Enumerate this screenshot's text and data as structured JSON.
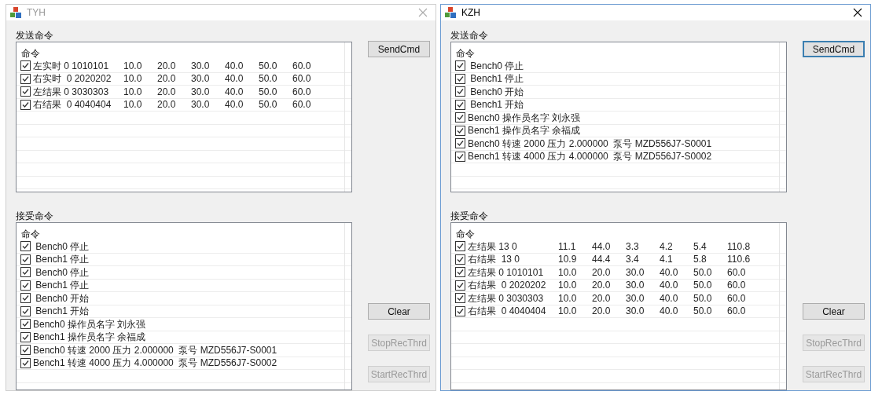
{
  "windows": [
    {
      "title": "TYH",
      "active": false,
      "send": {
        "label": "发送命令",
        "header": "命令",
        "rows": [
          {
            "checked": true,
            "cells": [
              "左实时 0 1010101",
              "10.0",
              "20.0",
              "30.0",
              "40.0",
              "50.0",
              "60.0"
            ]
          },
          {
            "checked": true,
            "cells": [
              "右实时  0 2020202",
              "10.0",
              "20.0",
              "30.0",
              "40.0",
              "50.0",
              "60.0"
            ]
          },
          {
            "checked": true,
            "cells": [
              "左结果 0 3030303",
              "10.0",
              "20.0",
              "30.0",
              "40.0",
              "50.0",
              "60.0"
            ]
          },
          {
            "checked": true,
            "cells": [
              "右结果  0 4040404",
              "10.0",
              "20.0",
              "30.0",
              "40.0",
              "50.0",
              "60.0"
            ]
          }
        ]
      },
      "receive": {
        "label": "接受命令",
        "header": "命令",
        "rows": [
          {
            "checked": true,
            "cells": [
              " Bench0 停止"
            ]
          },
          {
            "checked": true,
            "cells": [
              " Bench1 停止"
            ]
          },
          {
            "checked": true,
            "cells": [
              " Bench0 停止"
            ]
          },
          {
            "checked": true,
            "cells": [
              " Bench1 停止"
            ]
          },
          {
            "checked": true,
            "cells": [
              " Bench0 开始"
            ]
          },
          {
            "checked": true,
            "cells": [
              " Bench1 开始"
            ]
          },
          {
            "checked": true,
            "cells": [
              "Bench0 操作员名字 刘永强"
            ]
          },
          {
            "checked": true,
            "cells": [
              "Bench1 操作员名字 余福成"
            ]
          },
          {
            "checked": true,
            "cells": [
              "Bench0 转速 2000 压力 2.000000  泵号 MZD556J7-S0001"
            ]
          },
          {
            "checked": true,
            "cells": [
              "Bench1 转速 4000 压力 4.000000  泵号 MZD556J7-S0002"
            ]
          }
        ]
      },
      "buttons": [
        {
          "label": "SendCmd",
          "disabled": false,
          "focused": false
        },
        {
          "label": "Clear",
          "disabled": false,
          "focused": false
        },
        {
          "label": "StopRecThrd",
          "disabled": true,
          "focused": false
        },
        {
          "label": "StartRecThrd",
          "disabled": true,
          "focused": false
        }
      ]
    },
    {
      "title": "KZH",
      "active": true,
      "send": {
        "label": "发送命令",
        "header": "命令",
        "rows": [
          {
            "checked": true,
            "cells": [
              " Bench0 停止"
            ]
          },
          {
            "checked": true,
            "cells": [
              " Bench1 停止"
            ]
          },
          {
            "checked": true,
            "cells": [
              " Bench0 开始"
            ]
          },
          {
            "checked": true,
            "cells": [
              " Bench1 开始"
            ]
          },
          {
            "checked": true,
            "cells": [
              "Bench0 操作员名字 刘永强"
            ]
          },
          {
            "checked": true,
            "cells": [
              "Bench1 操作员名字 余福成"
            ]
          },
          {
            "checked": true,
            "cells": [
              "Bench0 转速 2000 压力 2.000000  泵号 MZD556J7-S0001"
            ]
          },
          {
            "checked": true,
            "cells": [
              "Bench1 转速 4000 压力 4.000000  泵号 MZD556J7-S0002"
            ]
          }
        ]
      },
      "receive": {
        "label": "接受命令",
        "header": "命令",
        "rows": [
          {
            "checked": true,
            "cells": [
              "左结果 13 0",
              "11.1",
              "44.0",
              "3.3",
              "4.2",
              "5.4",
              "110.8"
            ]
          },
          {
            "checked": true,
            "cells": [
              "右结果  13 0",
              "10.9",
              "44.4",
              "3.4",
              "4.1",
              "5.8",
              "110.6"
            ]
          },
          {
            "checked": true,
            "cells": [
              "左结果 0 1010101",
              "10.0",
              "20.0",
              "30.0",
              "40.0",
              "50.0",
              "60.0"
            ]
          },
          {
            "checked": true,
            "cells": [
              "右结果  0 2020202",
              "10.0",
              "20.0",
              "30.0",
              "40.0",
              "50.0",
              "60.0"
            ]
          },
          {
            "checked": true,
            "cells": [
              "左结果 0 3030303",
              "10.0",
              "20.0",
              "30.0",
              "40.0",
              "50.0",
              "60.0"
            ]
          },
          {
            "checked": true,
            "cells": [
              "右结果  0 4040404",
              "10.0",
              "20.0",
              "30.0",
              "40.0",
              "50.0",
              "60.0"
            ]
          }
        ]
      },
      "buttons": [
        {
          "label": "SendCmd",
          "disabled": false,
          "focused": true
        },
        {
          "label": "Clear",
          "disabled": false,
          "focused": false
        },
        {
          "label": "StopRecThrd",
          "disabled": true,
          "focused": false
        },
        {
          "label": "StartRecThrd",
          "disabled": true,
          "focused": false
        }
      ]
    }
  ]
}
